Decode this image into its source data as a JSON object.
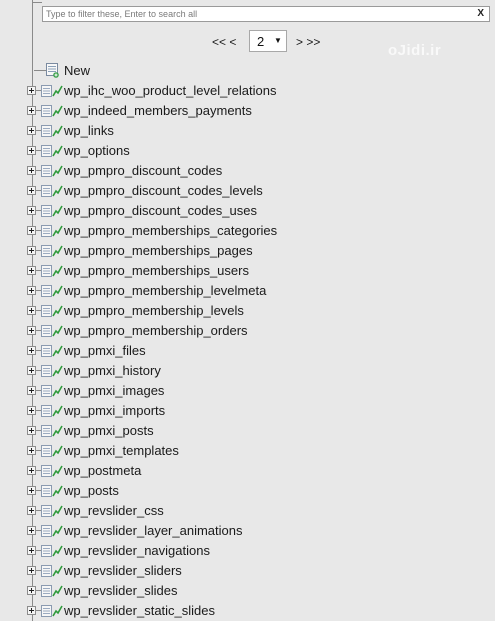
{
  "filter": {
    "placeholder": "Type to filter these, Enter to search all",
    "value": "",
    "clear_label": "X"
  },
  "pagination": {
    "prev_label": "<< <",
    "current_page": "2",
    "next_label": "> >>"
  },
  "watermark": "oJidi.ir",
  "tree": {
    "new_label": "New",
    "tables": [
      "wp_ihc_woo_product_level_relations",
      "wp_indeed_members_payments",
      "wp_links",
      "wp_options",
      "wp_pmpro_discount_codes",
      "wp_pmpro_discount_codes_levels",
      "wp_pmpro_discount_codes_uses",
      "wp_pmpro_memberships_categories",
      "wp_pmpro_memberships_pages",
      "wp_pmpro_memberships_users",
      "wp_pmpro_membership_levelmeta",
      "wp_pmpro_membership_levels",
      "wp_pmpro_membership_orders",
      "wp_pmxi_files",
      "wp_pmxi_history",
      "wp_pmxi_images",
      "wp_pmxi_imports",
      "wp_pmxi_posts",
      "wp_pmxi_templates",
      "wp_postmeta",
      "wp_posts",
      "wp_revslider_css",
      "wp_revslider_layer_animations",
      "wp_revslider_navigations",
      "wp_revslider_sliders",
      "wp_revslider_slides",
      "wp_revslider_static_slides"
    ]
  },
  "icons": {
    "expander": "plus-box-icon",
    "table": "table-icon",
    "new": "new-table-icon"
  },
  "colors": {
    "background": "#e8e8e8",
    "tree_line": "#8a8a8a",
    "icon_green": "#2e9a3a",
    "text": "#1a1a1a"
  }
}
